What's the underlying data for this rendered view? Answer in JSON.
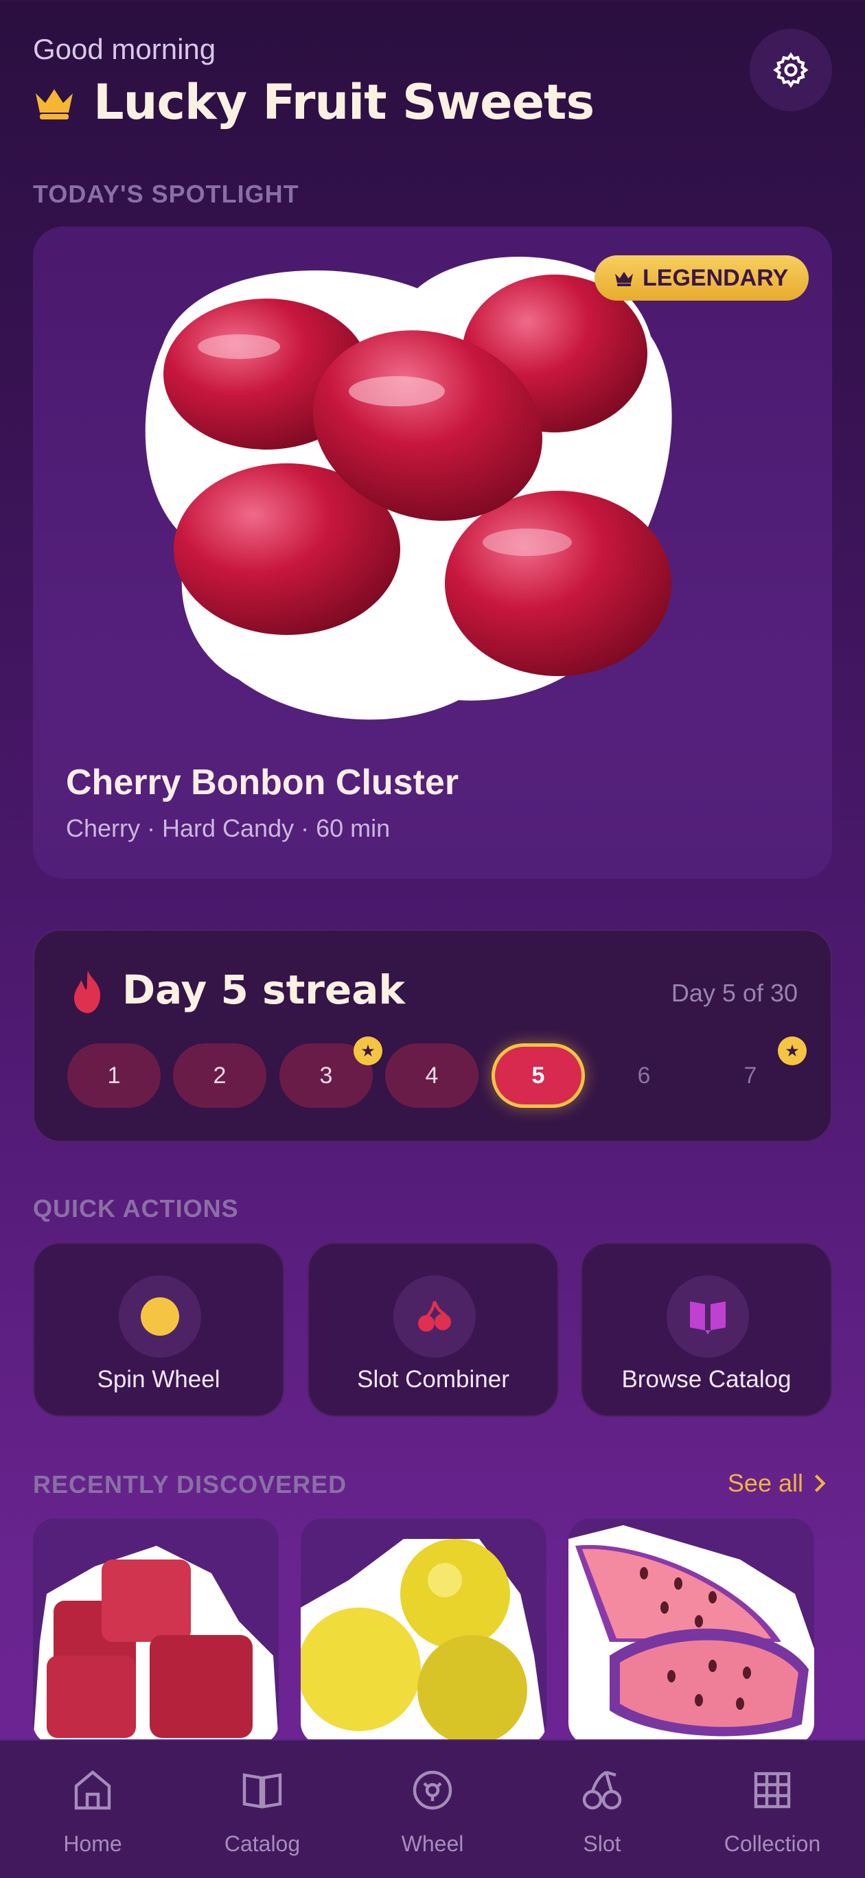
{
  "header": {
    "greeting": "Good morning",
    "title": "Lucky Fruit Sweets",
    "settings_icon": "gear-icon"
  },
  "spotlight": {
    "section_label": "TODAY'S SPOTLIGHT",
    "badge": "LEGENDARY",
    "name": "Cherry Bonbon Cluster",
    "meta": "Cherry · Hard Candy · 60 min"
  },
  "streak": {
    "title": "Day 5 streak",
    "progress": "Day 5 of 30",
    "days": [
      {
        "label": "1",
        "state": "done",
        "star": false
      },
      {
        "label": "2",
        "state": "done",
        "star": false
      },
      {
        "label": "3",
        "state": "done",
        "star": true
      },
      {
        "label": "4",
        "state": "done",
        "star": false
      },
      {
        "label": "5",
        "state": "active",
        "star": false
      },
      {
        "label": "6",
        "state": "future",
        "star": false
      },
      {
        "label": "7",
        "state": "future",
        "star": true
      }
    ]
  },
  "quick_actions": {
    "section_label": "QUICK ACTIONS",
    "items": [
      {
        "label": "Spin Wheel",
        "icon": "yellow-circle-icon"
      },
      {
        "label": "Slot Combiner",
        "icon": "cherry-icon"
      },
      {
        "label": "Browse Catalog",
        "icon": "book-icon"
      }
    ]
  },
  "recent": {
    "section_label": "RECENTLY DISCOVERED",
    "see_all": "See all"
  },
  "nav": {
    "items": [
      {
        "label": "Home",
        "icon": "home-icon"
      },
      {
        "label": "Catalog",
        "icon": "book-icon"
      },
      {
        "label": "Wheel",
        "icon": "wheel-icon"
      },
      {
        "label": "Slot",
        "icon": "cherry-icon"
      },
      {
        "label": "Collection",
        "icon": "grid-icon"
      }
    ]
  },
  "colors": {
    "accent_gold": "#f5c542",
    "streak_active": "#d8294f",
    "see_all": "#f0b341"
  }
}
